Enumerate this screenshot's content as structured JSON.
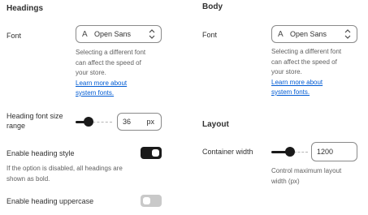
{
  "headings": {
    "title": "Headings",
    "font": {
      "label": "Font",
      "value": "Open Sans",
      "font_icon": "A",
      "help_line1": "Selecting a different font",
      "help_line2": "can affect the speed of",
      "help_line3": "your store.",
      "link_line1": "Learn more about",
      "link_line2": "system fonts."
    },
    "size_range": {
      "label_line1": "Heading font size",
      "label_line2": "range",
      "value": "36",
      "unit": "px",
      "level": 0.36
    },
    "heading_style": {
      "label": "Enable heading style",
      "enabled": true,
      "help_line1": "If the option is disabled, all headings are",
      "help_line2": "shown as bold."
    },
    "uppercase": {
      "label": "Enable heading uppercase",
      "enabled": false
    }
  },
  "body": {
    "title": "Body",
    "font": {
      "label": "Font",
      "value": "Open Sans",
      "font_icon": "A",
      "help_line1": "Selecting a different font",
      "help_line2": "can affect the speed of",
      "help_line3": "your store.",
      "link_line1": "Learn more about",
      "link_line2": "system fonts."
    }
  },
  "layout": {
    "title": "Layout",
    "container_width": {
      "label": "Container width",
      "value": "1200",
      "level": 0.5,
      "help_line1": "Control maximum layout",
      "help_line2": "width (px)"
    }
  }
}
